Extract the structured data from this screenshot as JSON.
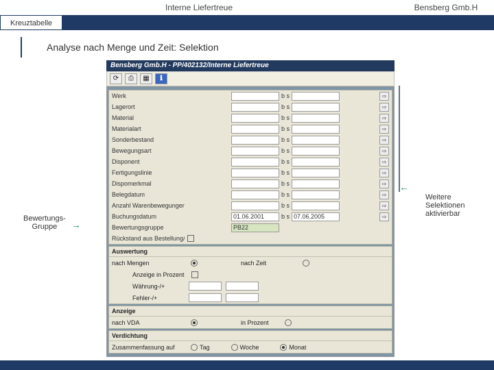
{
  "header": {
    "title": "Interne Liefertreue",
    "brand": "Bensberg Gmb.H",
    "tab": "Kreuztabelle",
    "heading": "Analyse nach Menge und Zeit: Selektion"
  },
  "sap": {
    "wintitle": "Bensberg Gmb.H - PP/402132/Interne Liefertreue",
    "toolbar": [
      "⟳",
      "⎙",
      "▦",
      "ℹ"
    ]
  },
  "selection": {
    "rows": [
      {
        "label": "Werk",
        "mid": "b s",
        "btn": "⇨"
      },
      {
        "label": "Lagerort",
        "mid": "b s",
        "btn": "⇨"
      },
      {
        "label": "Material",
        "mid": "b s",
        "btn": "⇨"
      },
      {
        "label": "Materialart",
        "mid": "b s",
        "btn": "⇨"
      },
      {
        "label": "Sonderbestand",
        "mid": "b s",
        "btn": "⇨"
      },
      {
        "label": "Bewegungsart",
        "mid": "b s",
        "btn": "⇨"
      },
      {
        "label": "Disponent",
        "mid": "b s",
        "btn": "⇨"
      },
      {
        "label": "Fertigungslinie",
        "mid": "b s",
        "btn": "⇨"
      },
      {
        "label": "Dispomerkmal",
        "mid": "b s",
        "btn": "⇨"
      },
      {
        "label": "Belegdatum",
        "mid": "b s",
        "btn": "⇨"
      },
      {
        "label": "Anzahl Warenbewegungen",
        "mid": "b s",
        "btn": "⇨"
      },
      {
        "label": "Buchungsdatum",
        "from": "01.06.2001",
        "mid": "b s",
        "to": "07.06.2005",
        "btn": "⇨"
      },
      {
        "label": "Bewertungsgruppe",
        "from": "PB22",
        "mid": "",
        "btn": ""
      },
      {
        "label": "Rückstand aus Bestellung/LP",
        "chk": true
      }
    ]
  },
  "eval": {
    "title": "Auswertung",
    "row1_lbl": "nach Mengen",
    "row1_opt": "nach Zeit",
    "row2_lbl": "Anzeige in Prozent",
    "row3_lbl": "Währung-/+",
    "row4_lbl": "Fehler-/+"
  },
  "display": {
    "title": "Anzeige",
    "lbl": "nach VDA",
    "opt": "in Prozent"
  },
  "compact": {
    "title": "Verdichtung",
    "lbl": "Zusammenfassung auf",
    "o1": "Tag",
    "o2": "Woche",
    "o3": "Monat"
  },
  "annots": {
    "left1": "Bewertungs-",
    "left2": "Gruppe",
    "arrow_l": "→",
    "arrow_r": "←",
    "right1": "Weitere",
    "right2": "Selektionen",
    "right3": "aktivierbar"
  }
}
